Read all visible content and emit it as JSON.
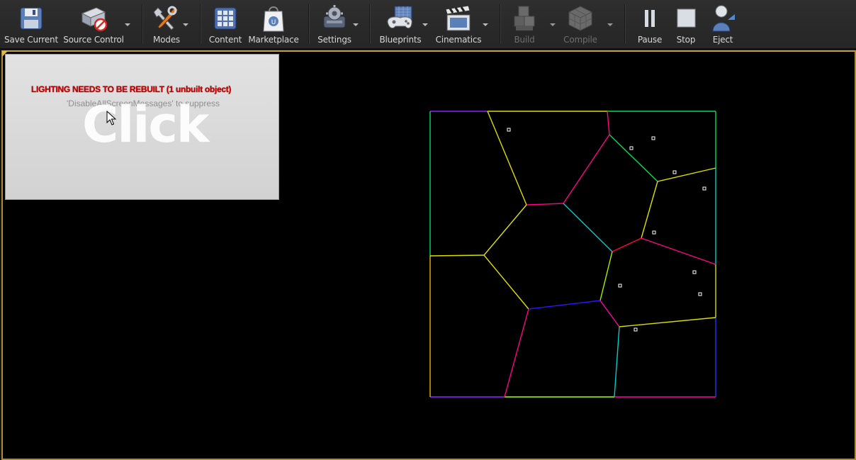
{
  "toolbar": {
    "buttons": [
      {
        "id": "save_current",
        "label": "Save Current",
        "enabled": true,
        "icon": "floppy-disk-icon"
      },
      {
        "id": "source_control",
        "label": "Source Control",
        "enabled": true,
        "icon": "source-control-icon"
      },
      {
        "id": "modes",
        "label": "Modes",
        "enabled": true,
        "icon": "modes-tools-icon"
      },
      {
        "id": "content",
        "label": "Content",
        "enabled": true,
        "icon": "content-grid-icon"
      },
      {
        "id": "marketplace",
        "label": "Marketplace",
        "enabled": true,
        "icon": "marketplace-bag-icon"
      },
      {
        "id": "settings",
        "label": "Settings",
        "enabled": true,
        "icon": "settings-gears-icon"
      },
      {
        "id": "blueprints",
        "label": "Blueprints",
        "enabled": true,
        "icon": "blueprints-gamepad-icon"
      },
      {
        "id": "cinematics",
        "label": "Cinematics",
        "enabled": true,
        "icon": "clapperboard-icon"
      },
      {
        "id": "build",
        "label": "Build",
        "enabled": false,
        "icon": "build-blocks-icon"
      },
      {
        "id": "compile",
        "label": "Compile",
        "enabled": false,
        "icon": "compile-cube-icon"
      },
      {
        "id": "pause",
        "label": "Pause",
        "enabled": true,
        "icon": "pause-icon"
      },
      {
        "id": "stop",
        "label": "Stop",
        "enabled": true,
        "icon": "stop-icon"
      },
      {
        "id": "eject",
        "label": "Eject",
        "enabled": true,
        "icon": "eject-person-icon"
      }
    ]
  },
  "viewport": {
    "messages": {
      "lighting_warning": "LIGHTING NEEDS TO BE REBUILT (1 unbuilt object)",
      "suppress_hint": "'DisableAllScreenMessages' to suppress",
      "click_text": "Click"
    },
    "colors": {
      "border": "#b08d2b",
      "warning": "#c40000",
      "edges": [
        "#ffff00",
        "#ff00aa",
        "#00ffff",
        "#00ff66",
        "#2222ff",
        "#9922ff",
        "#ffaa00",
        "#aaff00"
      ]
    }
  }
}
